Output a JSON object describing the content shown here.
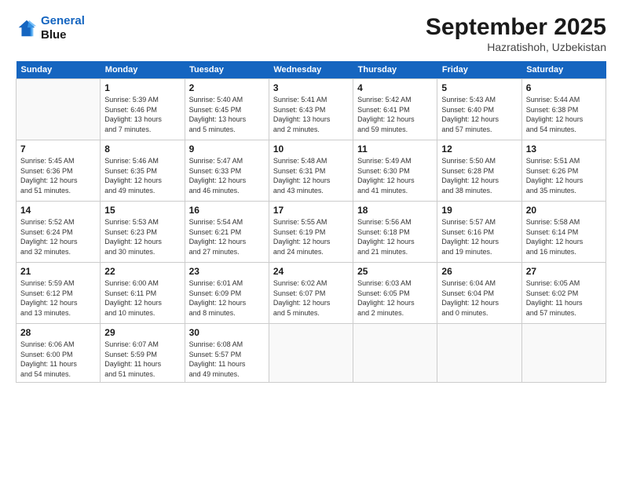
{
  "header": {
    "logo_line1": "General",
    "logo_line2": "Blue",
    "month": "September 2025",
    "location": "Hazratishoh, Uzbekistan"
  },
  "weekdays": [
    "Sunday",
    "Monday",
    "Tuesday",
    "Wednesday",
    "Thursday",
    "Friday",
    "Saturday"
  ],
  "weeks": [
    [
      {
        "day": "",
        "info": ""
      },
      {
        "day": "1",
        "info": "Sunrise: 5:39 AM\nSunset: 6:46 PM\nDaylight: 13 hours\nand 7 minutes."
      },
      {
        "day": "2",
        "info": "Sunrise: 5:40 AM\nSunset: 6:45 PM\nDaylight: 13 hours\nand 5 minutes."
      },
      {
        "day": "3",
        "info": "Sunrise: 5:41 AM\nSunset: 6:43 PM\nDaylight: 13 hours\nand 2 minutes."
      },
      {
        "day": "4",
        "info": "Sunrise: 5:42 AM\nSunset: 6:41 PM\nDaylight: 12 hours\nand 59 minutes."
      },
      {
        "day": "5",
        "info": "Sunrise: 5:43 AM\nSunset: 6:40 PM\nDaylight: 12 hours\nand 57 minutes."
      },
      {
        "day": "6",
        "info": "Sunrise: 5:44 AM\nSunset: 6:38 PM\nDaylight: 12 hours\nand 54 minutes."
      }
    ],
    [
      {
        "day": "7",
        "info": "Sunrise: 5:45 AM\nSunset: 6:36 PM\nDaylight: 12 hours\nand 51 minutes."
      },
      {
        "day": "8",
        "info": "Sunrise: 5:46 AM\nSunset: 6:35 PM\nDaylight: 12 hours\nand 49 minutes."
      },
      {
        "day": "9",
        "info": "Sunrise: 5:47 AM\nSunset: 6:33 PM\nDaylight: 12 hours\nand 46 minutes."
      },
      {
        "day": "10",
        "info": "Sunrise: 5:48 AM\nSunset: 6:31 PM\nDaylight: 12 hours\nand 43 minutes."
      },
      {
        "day": "11",
        "info": "Sunrise: 5:49 AM\nSunset: 6:30 PM\nDaylight: 12 hours\nand 41 minutes."
      },
      {
        "day": "12",
        "info": "Sunrise: 5:50 AM\nSunset: 6:28 PM\nDaylight: 12 hours\nand 38 minutes."
      },
      {
        "day": "13",
        "info": "Sunrise: 5:51 AM\nSunset: 6:26 PM\nDaylight: 12 hours\nand 35 minutes."
      }
    ],
    [
      {
        "day": "14",
        "info": "Sunrise: 5:52 AM\nSunset: 6:24 PM\nDaylight: 12 hours\nand 32 minutes."
      },
      {
        "day": "15",
        "info": "Sunrise: 5:53 AM\nSunset: 6:23 PM\nDaylight: 12 hours\nand 30 minutes."
      },
      {
        "day": "16",
        "info": "Sunrise: 5:54 AM\nSunset: 6:21 PM\nDaylight: 12 hours\nand 27 minutes."
      },
      {
        "day": "17",
        "info": "Sunrise: 5:55 AM\nSunset: 6:19 PM\nDaylight: 12 hours\nand 24 minutes."
      },
      {
        "day": "18",
        "info": "Sunrise: 5:56 AM\nSunset: 6:18 PM\nDaylight: 12 hours\nand 21 minutes."
      },
      {
        "day": "19",
        "info": "Sunrise: 5:57 AM\nSunset: 6:16 PM\nDaylight: 12 hours\nand 19 minutes."
      },
      {
        "day": "20",
        "info": "Sunrise: 5:58 AM\nSunset: 6:14 PM\nDaylight: 12 hours\nand 16 minutes."
      }
    ],
    [
      {
        "day": "21",
        "info": "Sunrise: 5:59 AM\nSunset: 6:12 PM\nDaylight: 12 hours\nand 13 minutes."
      },
      {
        "day": "22",
        "info": "Sunrise: 6:00 AM\nSunset: 6:11 PM\nDaylight: 12 hours\nand 10 minutes."
      },
      {
        "day": "23",
        "info": "Sunrise: 6:01 AM\nSunset: 6:09 PM\nDaylight: 12 hours\nand 8 minutes."
      },
      {
        "day": "24",
        "info": "Sunrise: 6:02 AM\nSunset: 6:07 PM\nDaylight: 12 hours\nand 5 minutes."
      },
      {
        "day": "25",
        "info": "Sunrise: 6:03 AM\nSunset: 6:05 PM\nDaylight: 12 hours\nand 2 minutes."
      },
      {
        "day": "26",
        "info": "Sunrise: 6:04 AM\nSunset: 6:04 PM\nDaylight: 12 hours\nand 0 minutes."
      },
      {
        "day": "27",
        "info": "Sunrise: 6:05 AM\nSunset: 6:02 PM\nDaylight: 11 hours\nand 57 minutes."
      }
    ],
    [
      {
        "day": "28",
        "info": "Sunrise: 6:06 AM\nSunset: 6:00 PM\nDaylight: 11 hours\nand 54 minutes."
      },
      {
        "day": "29",
        "info": "Sunrise: 6:07 AM\nSunset: 5:59 PM\nDaylight: 11 hours\nand 51 minutes."
      },
      {
        "day": "30",
        "info": "Sunrise: 6:08 AM\nSunset: 5:57 PM\nDaylight: 11 hours\nand 49 minutes."
      },
      {
        "day": "",
        "info": ""
      },
      {
        "day": "",
        "info": ""
      },
      {
        "day": "",
        "info": ""
      },
      {
        "day": "",
        "info": ""
      }
    ]
  ]
}
